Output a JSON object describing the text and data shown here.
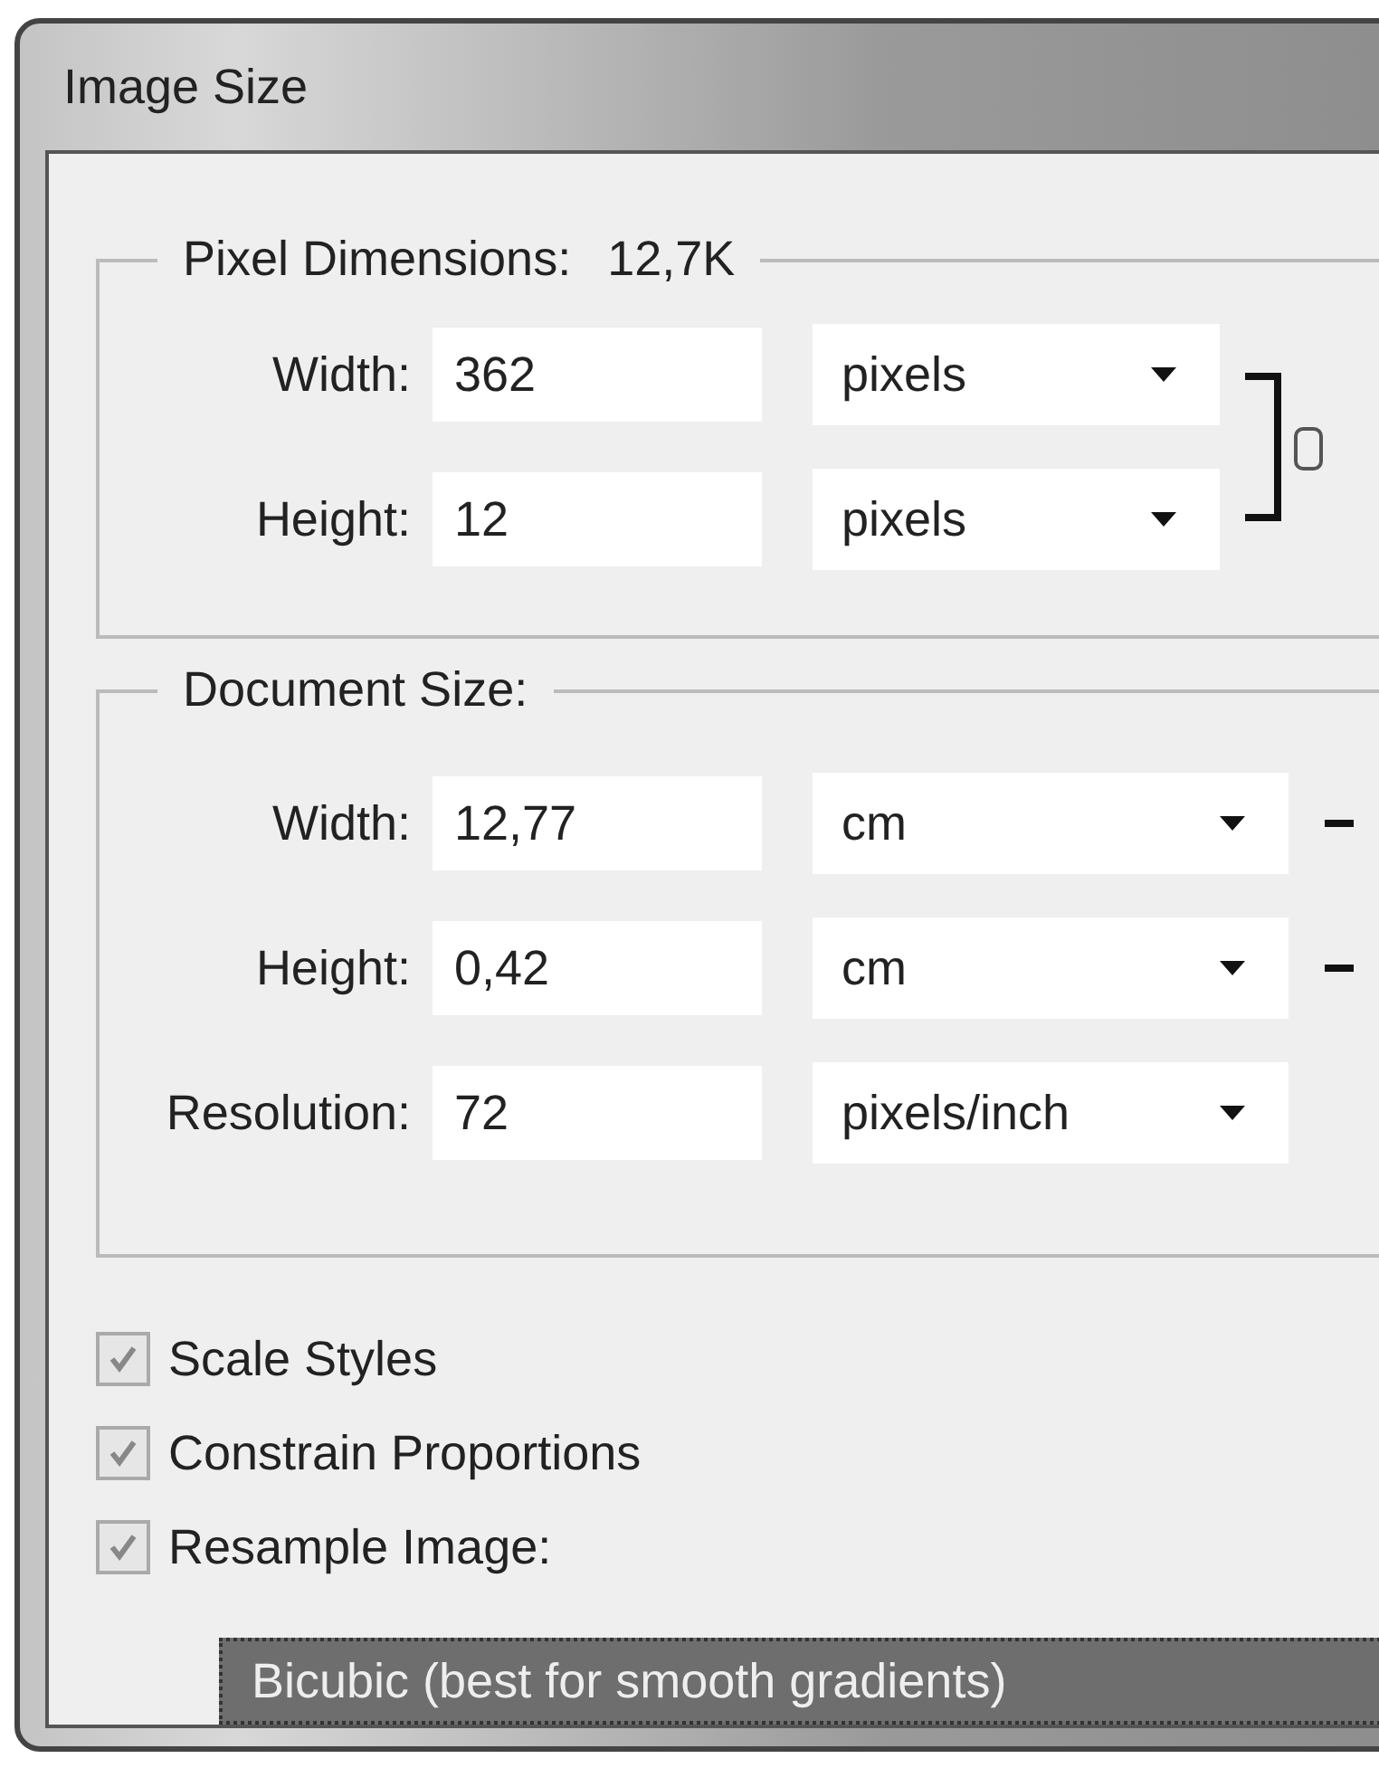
{
  "window": {
    "title": "Image Size"
  },
  "pixel_dimensions": {
    "label": "Pixel Dimensions:",
    "value": "12,7K",
    "linked": true,
    "fields": [
      {
        "label": "Width:",
        "value": "362",
        "unit": "pixels"
      },
      {
        "label": "Height:",
        "value": "12",
        "unit": "pixels"
      }
    ]
  },
  "document_size": {
    "label": "Document Size:",
    "fields": [
      {
        "label": "Width:",
        "value": "12,77",
        "unit": "cm",
        "linked": true
      },
      {
        "label": "Height:",
        "value": "0,42",
        "unit": "cm",
        "linked": true
      },
      {
        "label": "Resolution:",
        "value": "72",
        "unit": "pixels/inch",
        "linked": false
      }
    ]
  },
  "options": [
    {
      "label": "Scale Styles",
      "checked": true
    },
    {
      "label": "Constrain Proportions",
      "checked": true
    },
    {
      "label": "Resample Image:",
      "checked": true
    }
  ],
  "resample_method": {
    "value": "Bicubic (best for smooth gradients)"
  }
}
